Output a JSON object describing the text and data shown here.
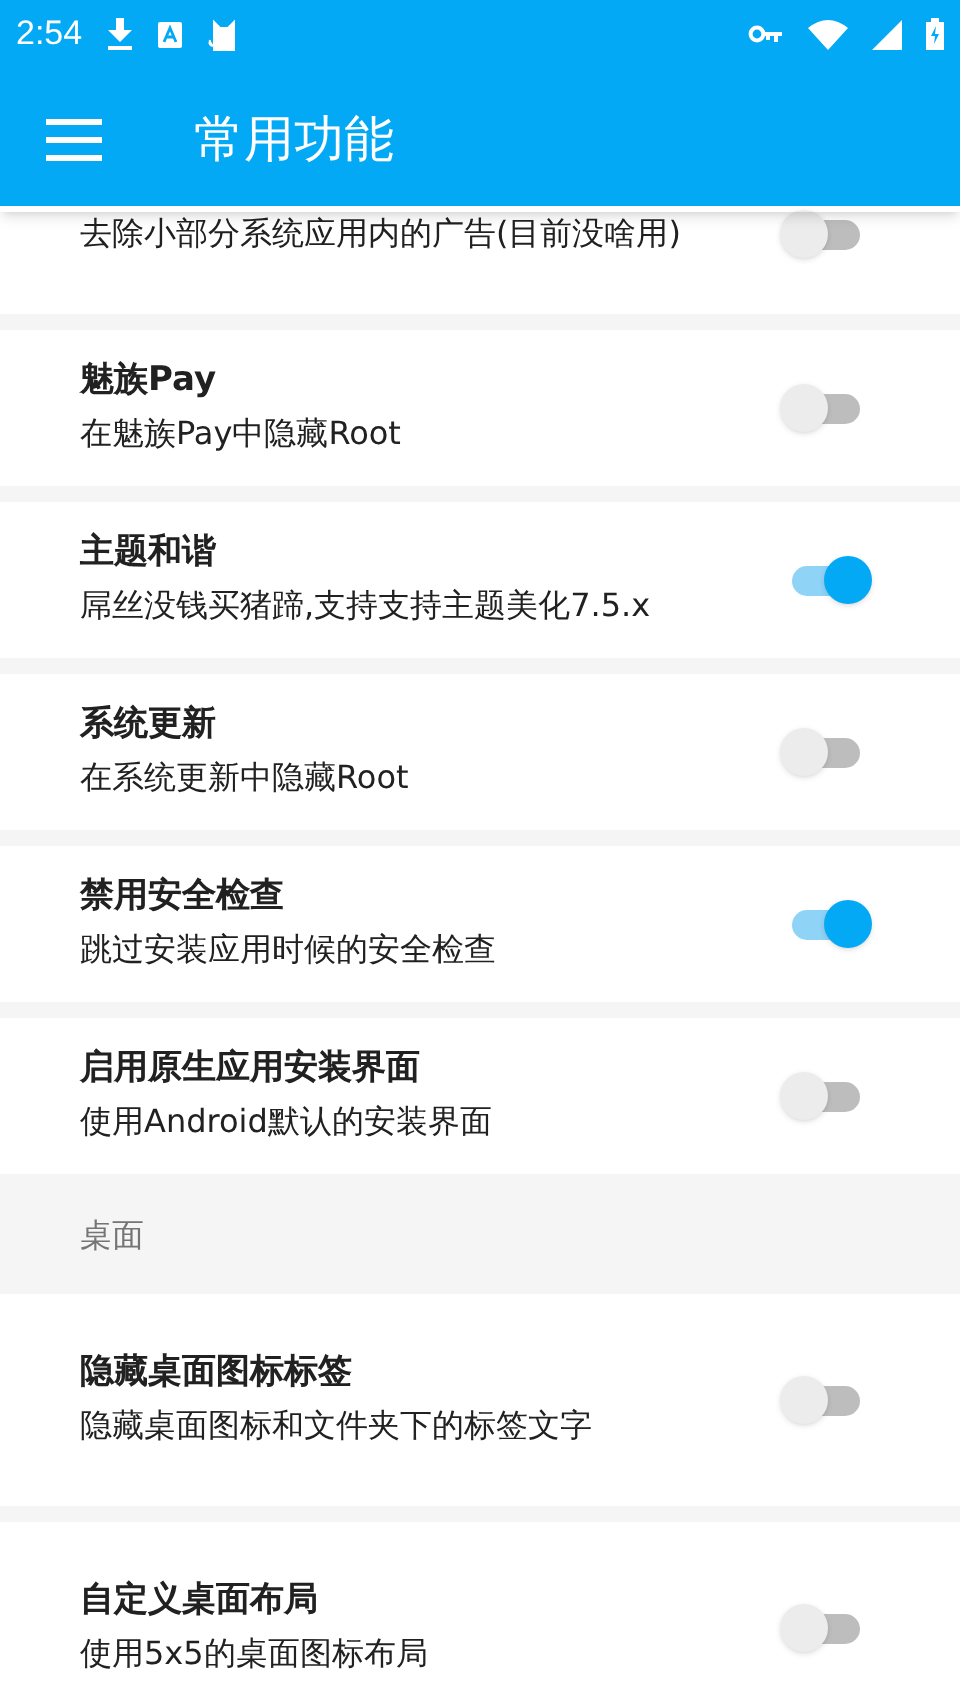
{
  "status_bar": {
    "time": "2:54"
  },
  "app_bar": {
    "title": "常用功能"
  },
  "sections": [
    {
      "items": [
        {
          "description": "去除小部分系统应用内的广告(目前没啥用)",
          "on": false
        },
        {
          "title": "魅族Pay",
          "description": "在魅族Pay中隐藏Root",
          "on": false
        },
        {
          "title": "主题和谐",
          "description": "屌丝没钱买猪蹄,支持支持主题美化7.5.x",
          "on": true
        },
        {
          "title": "系统更新",
          "description": "在系统更新中隐藏Root",
          "on": false
        },
        {
          "title": "禁用安全检查",
          "description": "跳过安装应用时候的安全检查",
          "on": true
        },
        {
          "title": "启用原生应用安装界面",
          "description": "使用Android默认的安装界面",
          "on": false
        }
      ]
    },
    {
      "header": "桌面",
      "items": [
        {
          "title": "隐藏桌面图标标签",
          "description": "隐藏桌面图标和文件夹下的标签文字",
          "on": false
        },
        {
          "title": "自定义桌面布局",
          "description": "使用5x5的桌面图标布局",
          "on": false
        }
      ]
    }
  ]
}
